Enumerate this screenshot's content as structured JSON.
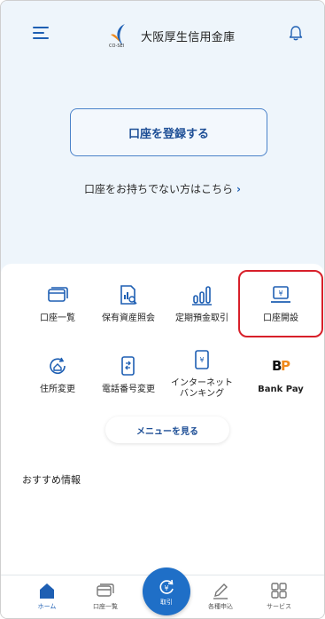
{
  "header": {
    "logo_text": "大阪厚生信用金庫",
    "logo_sub": "CO-SEI"
  },
  "main": {
    "register_label": "口座を登録する",
    "no_account_label": "口座をお持ちでない方はこちら",
    "no_account_chevron": "›"
  },
  "menu": {
    "items": [
      {
        "label": "口座一覧",
        "icon": "account-card-icon"
      },
      {
        "label": "保有資産照会",
        "icon": "asset-inquiry-icon"
      },
      {
        "label": "定期預金取引",
        "icon": "time-deposit-icon"
      },
      {
        "label": "口座開設",
        "icon": "account-opening-icon"
      },
      {
        "label": "住所変更",
        "icon": "address-change-icon"
      },
      {
        "label": "電話番号変更",
        "icon": "phone-change-icon"
      },
      {
        "label": "インターネット\nバンキング",
        "icon": "internet-banking-icon"
      },
      {
        "label": "Bank Pay",
        "icon": "bankpay-icon"
      }
    ],
    "more_label": "メニューを見る",
    "recommended_heading": "おすすめ情報"
  },
  "nav": {
    "home": "ホーム",
    "accounts": "口座一覧",
    "transaction": "取引",
    "applications": "各種申込",
    "services": "サービス"
  },
  "colors": {
    "accent": "#1e5fb3",
    "highlight": "#d8202a",
    "logo_orange": "#f08a1c"
  }
}
